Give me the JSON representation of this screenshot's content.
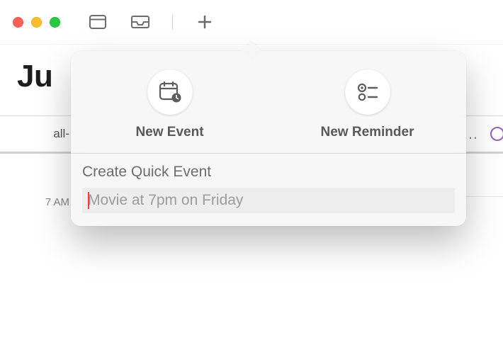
{
  "month_title": "Ju",
  "all_day_label": "all-",
  "hour_label_7am": "7 AM",
  "popover": {
    "new_event_label": "New Event",
    "new_reminder_label": "New Reminder",
    "quick_event_title": "Create Quick Event",
    "quick_event_placeholder": "Movie at 7pm on Friday",
    "quick_event_value": ""
  },
  "overflow_indicator": "…"
}
